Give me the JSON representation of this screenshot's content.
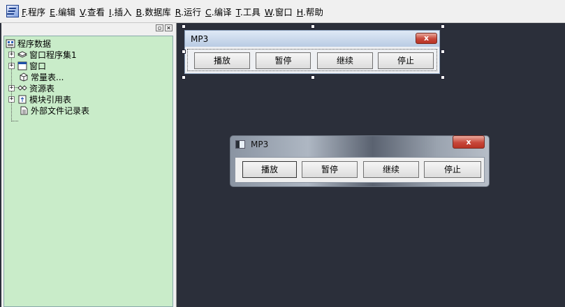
{
  "menubar": {
    "items": [
      {
        "key": "F",
        "label": ".程序"
      },
      {
        "key": "E",
        "label": ".编辑"
      },
      {
        "key": "V",
        "label": ".查看"
      },
      {
        "key": "I",
        "label": ".插入"
      },
      {
        "key": "B",
        "label": ".数据库"
      },
      {
        "key": "R",
        "label": ".运行"
      },
      {
        "key": "C",
        "label": ".编译"
      },
      {
        "key": "T",
        "label": ".工具"
      },
      {
        "key": "W",
        "label": ".窗口"
      },
      {
        "key": "H",
        "label": ".帮助"
      }
    ]
  },
  "panel": {
    "restore_glyph": "▫",
    "close_glyph": "×"
  },
  "tree": {
    "root": "程序数据",
    "nodes": [
      {
        "label": "窗口程序集1",
        "expander": "+"
      },
      {
        "label": "窗口",
        "expander": "+"
      },
      {
        "label": "常量表...",
        "expander": ""
      },
      {
        "label": "资源表",
        "expander": "+"
      },
      {
        "label": "模块引用表",
        "expander": "+"
      },
      {
        "label": "外部文件记录表",
        "expander": ""
      }
    ]
  },
  "design_window": {
    "title": "MP3",
    "close_glyph": "x",
    "buttons": [
      "播放",
      "暂停",
      "继续",
      "停止"
    ]
  },
  "run_window": {
    "title": "MP3",
    "close_glyph": "x",
    "buttons": [
      "播放",
      "暂停",
      "继续",
      "停止"
    ]
  }
}
